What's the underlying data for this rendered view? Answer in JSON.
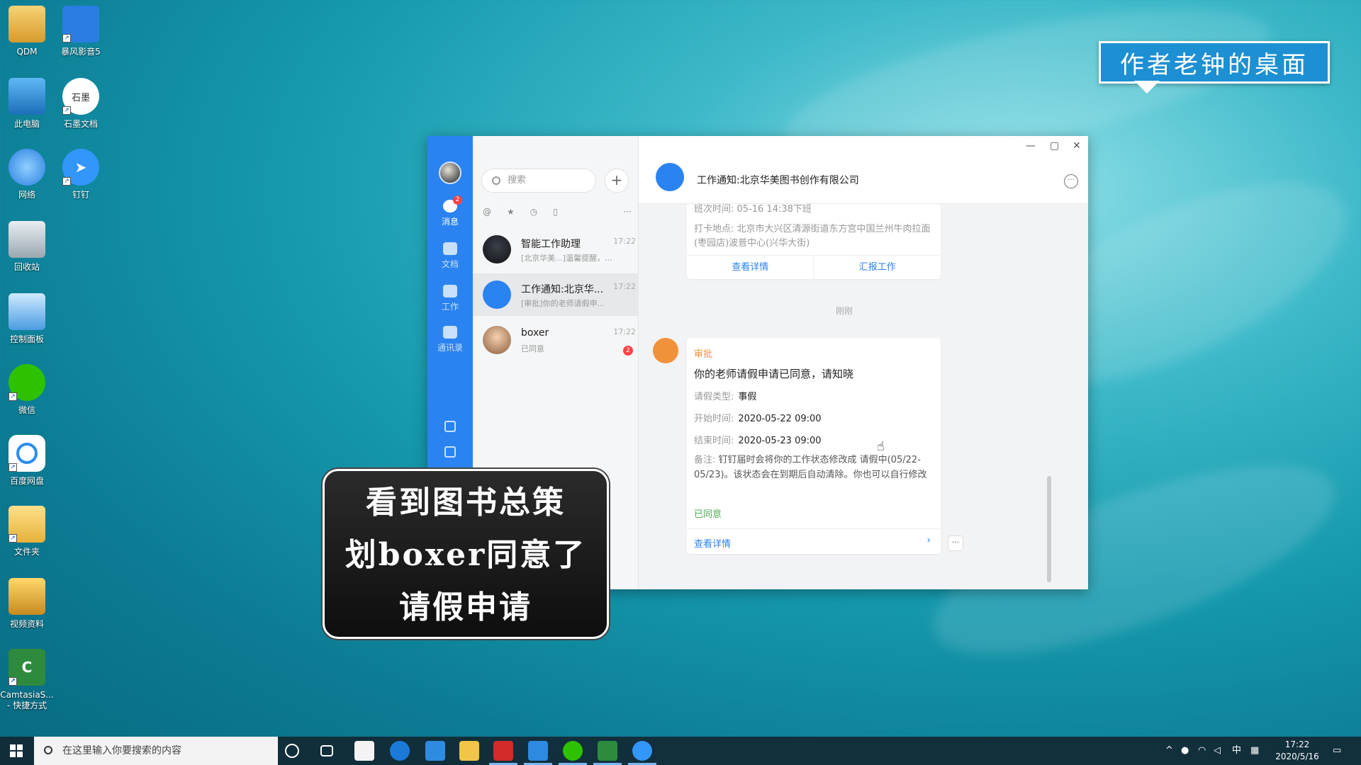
{
  "desktop": {
    "icons": [
      {
        "label": "QDM",
        "icon": "qdm-user-icon"
      },
      {
        "label": "暴风影音5",
        "icon": "baofeng-player-icon"
      },
      {
        "label": "此电脑",
        "icon": "computer-icon"
      },
      {
        "label": "石墨文档",
        "icon": "shimo-docs-icon",
        "glyph": "石墨"
      },
      {
        "label": "网络",
        "icon": "network-icon"
      },
      {
        "label": "钉钉",
        "icon": "dingtalk-icon"
      },
      {
        "label": "回收站",
        "icon": "recycle-bin-icon"
      },
      {
        "label": "控制面板",
        "icon": "control-panel-icon"
      },
      {
        "label": "微信",
        "icon": "wechat-icon"
      },
      {
        "label": "百度网盘",
        "icon": "baidu-netdisk-icon"
      },
      {
        "label": "文件夹",
        "icon": "folder-icon"
      },
      {
        "label": "视频资料",
        "icon": "video-archive-icon"
      },
      {
        "label": "CamtasiaS... - 快捷方式",
        "icon": "camtasia-icon"
      }
    ],
    "banner": "作者老钟的桌面"
  },
  "app": {
    "nav": {
      "messages_label": "消息",
      "messages_badge": "2",
      "docs_label": "文档",
      "work_label": "工作",
      "contacts_label": "通讯录"
    },
    "list": {
      "search_placeholder": "搜索",
      "add_glyph": "+",
      "filters": [
        "@",
        "★",
        "◷",
        "▯",
        "···"
      ],
      "conversations": [
        {
          "name": "智能工作助理",
          "preview": "[北京华美...]温馨提醒，...",
          "time": "17:22"
        },
        {
          "name": "工作通知:北京华...",
          "preview": "[审批]你的老师请假申...",
          "time": "17:22"
        },
        {
          "name": "boxer",
          "preview": "已同意",
          "time": "17:22",
          "badge": "2"
        }
      ]
    },
    "chat": {
      "title": "工作通知:北京华美图书创作有限公司",
      "card1": {
        "line1": "班次时间: 05-16 14:38下班",
        "line2": "打卡地点: 北京市大兴区清源街道东方宫中国兰州牛肉拉面(枣园店)波普中心(兴华大街)",
        "action_left": "查看详情",
        "action_right": "汇报工作"
      },
      "time_separator": "刚刚",
      "card2": {
        "tag": "审批",
        "title": "你的老师请假申请已同意，请知晓",
        "rows": [
          {
            "label": "请假类型:",
            "value": "事假"
          },
          {
            "label": "开始时间:",
            "value": "2020-05-22 09:00"
          },
          {
            "label": "结束时间:",
            "value": "2020-05-23 09:00"
          }
        ],
        "note_label": "备注:",
        "note_text": "钉钉届时会将你的工作状态修改成 请假中(05/22-05/23)。该状态会在到期后自动清除。你也可以自行修改",
        "status": "已同意",
        "detail_label": "查看详情"
      },
      "more_glyph": "···"
    },
    "window_controls": {
      "minimize": "—",
      "maximize": "▢",
      "close": "✕"
    }
  },
  "caption": {
    "line1": "看到图书总策",
    "line2": "划boxer同意了",
    "line3": "请假申请"
  },
  "taskbar": {
    "search_placeholder": "在这里输入你要搜索的内容",
    "ime": "中",
    "time": "17:22",
    "date": "2020/5/16"
  }
}
